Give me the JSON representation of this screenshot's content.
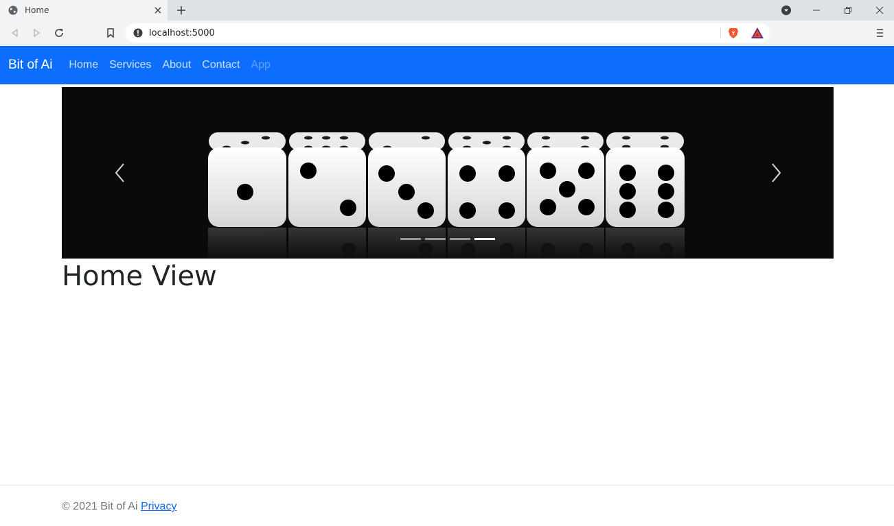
{
  "browser": {
    "tab_title": "Home",
    "url": "localhost:5000"
  },
  "navbar": {
    "brand": "Bit of Ai",
    "links": [
      {
        "label": "Home",
        "disabled": false
      },
      {
        "label": "Services",
        "disabled": false
      },
      {
        "label": "About",
        "disabled": false
      },
      {
        "label": "Contact",
        "disabled": false
      },
      {
        "label": "App",
        "disabled": true
      }
    ],
    "color": "#0d6efd"
  },
  "carousel": {
    "slide_subject": "six dice showing one to six",
    "slide_count": 4,
    "active_slide": 4
  },
  "main": {
    "title": "Home View"
  },
  "footer": {
    "copyright": "© 2021 Bit of Ai",
    "privacy_link": "Privacy"
  }
}
